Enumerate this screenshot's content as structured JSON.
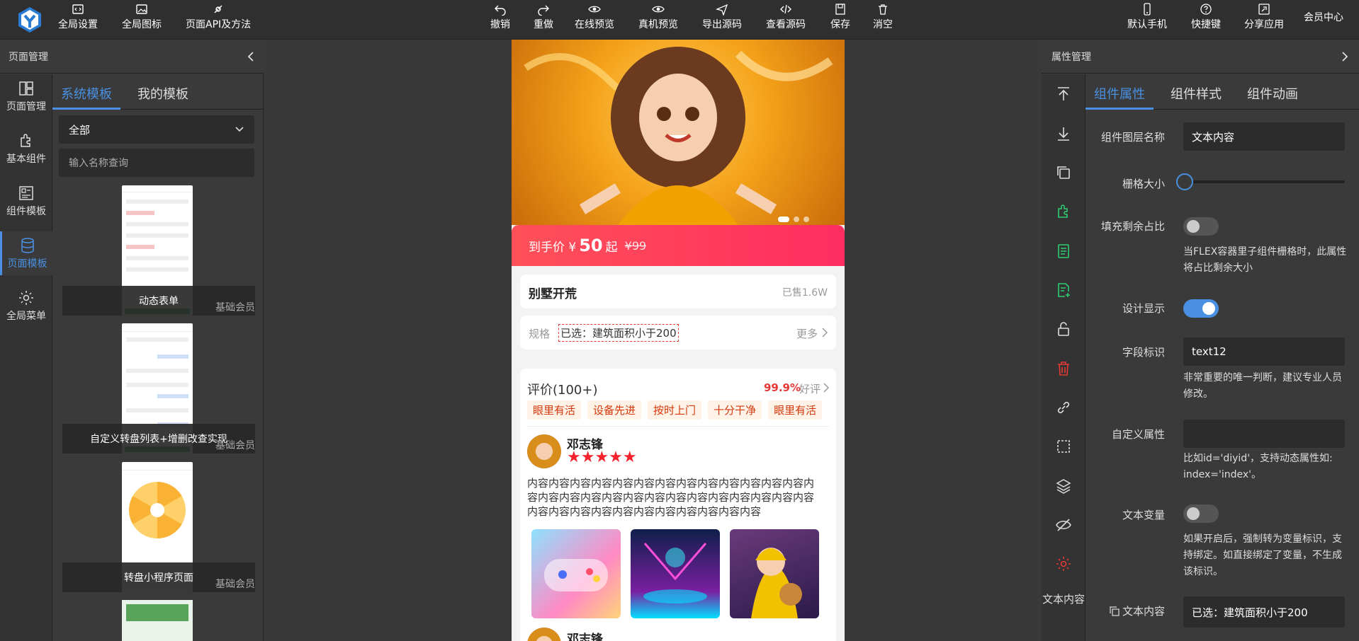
{
  "toolbar": {
    "left": [
      {
        "label": "全局设置",
        "icon": "code-settings-icon"
      },
      {
        "label": "全局图标",
        "icon": "image-icon"
      },
      {
        "label": "页面API及方法",
        "icon": "plug-icon"
      }
    ],
    "center": [
      {
        "label": "撤销",
        "icon": "undo-icon"
      },
      {
        "label": "重做",
        "icon": "redo-icon"
      },
      {
        "label": "在线预览",
        "icon": "eye-icon"
      },
      {
        "label": "真机预览",
        "icon": "eye-icon"
      },
      {
        "label": "导出源码",
        "icon": "send-icon"
      },
      {
        "label": "查看源码",
        "icon": "code-icon"
      },
      {
        "label": "保存",
        "icon": "save-icon"
      },
      {
        "label": "消空",
        "icon": "trash-icon"
      }
    ],
    "right": [
      {
        "label": "默认手机",
        "icon": "phone-icon"
      },
      {
        "label": "快捷键",
        "icon": "help-icon"
      },
      {
        "label": "分享应用",
        "icon": "share-icon"
      }
    ],
    "member": "会员中心"
  },
  "left_panel": {
    "title": "页面管理",
    "nav": [
      {
        "label": "页面管理",
        "icon": "layout-icon"
      },
      {
        "label": "基本组件",
        "icon": "puzzle-icon"
      },
      {
        "label": "组件模板",
        "icon": "template-icon"
      },
      {
        "label": "页面模板",
        "icon": "database-icon"
      },
      {
        "label": "全局菜单",
        "icon": "gear-icon"
      }
    ],
    "tabs": [
      "系统模板",
      "我的模板"
    ],
    "select_value": "全部",
    "search_placeholder": "输入名称查询",
    "templates": [
      {
        "name": "动态表单",
        "tag": "基础会员"
      },
      {
        "name": "自定义转盘列表+增删改查实现",
        "tag": "基础会员"
      },
      {
        "name": "转盘小程序页面",
        "tag": "基础会员"
      }
    ]
  },
  "phone": {
    "price_prefix": "到手价 ¥",
    "price": "50",
    "price_suffix": "起",
    "old_price": "¥99",
    "product_title": "别墅开荒",
    "sold": "已售1.6W",
    "spec_label": "规格",
    "spec_value": "已选：建筑面积小于200",
    "more": "更多",
    "review_title": "评价(100+)",
    "good_rate": "99.9%",
    "good_rate_label": "好评",
    "tags": [
      "眼里有活",
      "设备先进",
      "按时上门",
      "十分干净",
      "眼里有活"
    ],
    "reviewer": "邓志锋",
    "stars": "★★★★★",
    "review_text": "内容内容内容内容内容内容内容内容内容内容内容内容内容内容内容内容内容内容内容内容内容内容内容内容内容内容内容内容内容内容内容内容内容内容内容内容内容内容",
    "reviewer2": "邓志锋"
  },
  "right_panel": {
    "title": "属性管理",
    "tabs": [
      "组件属性",
      "组件样式",
      "组件动画"
    ],
    "tools": [
      "arrow-top-icon",
      "arrow-down-icon",
      "copy-icon",
      "puzzle-icon",
      "document-icon",
      "document-add-icon",
      "unlock-icon",
      "trash-icon",
      "link-icon",
      "select-icon",
      "layers-icon",
      "eye-off-icon",
      "gear-icon"
    ],
    "tool_text": "文本内容",
    "props": {
      "layer_name_label": "组件图层名称",
      "layer_name": "文本内容",
      "grid_label": "栅格大小",
      "grid_value": 0,
      "fill_label": "填充剩余占比",
      "fill_help": "当FLEX容器里子组件栅格时，此属性将占比剩余大小",
      "design_label": "设计显示",
      "field_label": "字段标识",
      "field_value": "text12",
      "field_help": "非常重要的唯一判断，建议专业人员修改。",
      "custom_label": "自定义属性",
      "custom_value": "",
      "custom_help": "比如id='diyid'，支持动态属性如: index='index'。",
      "var_label": "文本变量",
      "var_help": "如果开启后，强制转为变量标识，支持绑定。如直接绑定了变量，不生成该标识。",
      "content_label": "文本内容",
      "content_value": "已选：建筑面积小于200"
    }
  },
  "colors": {
    "accent": "#4a90e2",
    "price": "#ff3d5d",
    "danger": "#e53935",
    "green": "#2ecc71"
  }
}
